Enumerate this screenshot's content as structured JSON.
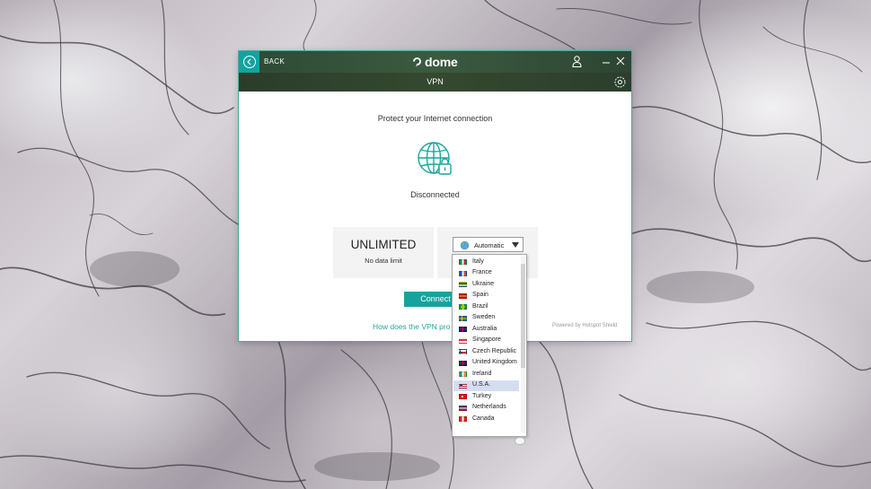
{
  "window": {
    "back_label": "BACK",
    "brand": "dome",
    "subtitle": "VPN"
  },
  "main": {
    "protect_text": "Protect your Internet connection",
    "status": "Disconnected",
    "plan_title": "UNLIMITED",
    "plan_sub": "No data limit",
    "location_selected": "Automatic",
    "connect_label": "Connect",
    "help_link": "How does the VPN pro",
    "powered_by": "Powered by Hotspot Shield"
  },
  "dropdown": {
    "items": [
      {
        "label": "Italy",
        "flag": "italy-flag-icon",
        "colors": [
          "#009246",
          "#ffffff",
          "#ce2b37"
        ],
        "dir": "v"
      },
      {
        "label": "France",
        "flag": "france-flag-icon",
        "colors": [
          "#0055a4",
          "#ffffff",
          "#ef4135"
        ],
        "dir": "v"
      },
      {
        "label": "Ukraine",
        "flag": "ukraine-flag-icon",
        "colors": [
          "#0057b7",
          "#ffd700"
        ],
        "dir": "h"
      },
      {
        "label": "Spain",
        "flag": "spain-flag-icon",
        "colors": [
          "#c60b1e",
          "#ffc400",
          "#c60b1e"
        ],
        "dir": "h"
      },
      {
        "label": "Brazil",
        "flag": "brazil-flag-icon",
        "colors": [
          "#009c3b",
          "#ffdf00",
          "#002776"
        ],
        "dir": "d"
      },
      {
        "label": "Sweden",
        "flag": "sweden-flag-icon",
        "colors": [
          "#006aa7",
          "#fecc00"
        ],
        "dir": "x"
      },
      {
        "label": "Australia",
        "flag": "australia-flag-icon",
        "colors": [
          "#012169",
          "#ffffff",
          "#e4002b"
        ],
        "dir": "u"
      },
      {
        "label": "Singapore",
        "flag": "singapore-flag-icon",
        "colors": [
          "#ef3340",
          "#ffffff"
        ],
        "dir": "h"
      },
      {
        "label": "Czech Republic",
        "flag": "czech-flag-icon",
        "colors": [
          "#ffffff",
          "#d7141a",
          "#11457e"
        ],
        "dir": "c"
      },
      {
        "label": "United Kingdom",
        "flag": "uk-flag-icon",
        "colors": [
          "#012169",
          "#ffffff",
          "#c8102e"
        ],
        "dir": "u"
      },
      {
        "label": "Ireland",
        "flag": "ireland-flag-icon",
        "colors": [
          "#169b62",
          "#ffffff",
          "#ff883e"
        ],
        "dir": "v"
      },
      {
        "label": "U.S.A.",
        "flag": "usa-flag-icon",
        "colors": [
          "#b22234",
          "#ffffff",
          "#3c3b6e"
        ],
        "dir": "s",
        "selected": true
      },
      {
        "label": "Turkey",
        "flag": "turkey-flag-icon",
        "colors": [
          "#e30a17",
          "#ffffff"
        ],
        "dir": "t"
      },
      {
        "label": "Netherlands",
        "flag": "netherlands-flag-icon",
        "colors": [
          "#ae1c28",
          "#ffffff",
          "#21468b"
        ],
        "dir": "h"
      },
      {
        "label": "Canada",
        "flag": "canada-flag-icon",
        "colors": [
          "#d52b1e",
          "#ffffff",
          "#d52b1e"
        ],
        "dir": "v"
      }
    ]
  },
  "colors": {
    "accent": "#17a39d",
    "titlebar": "#34502f",
    "selected_row": "#d4def0"
  }
}
